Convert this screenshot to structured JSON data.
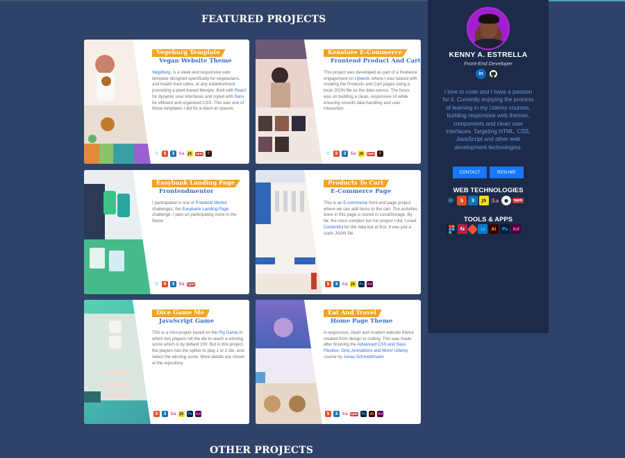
{
  "sections": {
    "featured": "FEATURED PROJECTS",
    "other": "OTHER PROJECTS"
  },
  "projects": [
    {
      "title": "Vegeburg Template",
      "subtitle": "Vegan Website Theme",
      "desc": [
        {
          "t": "Vegeburg",
          "link": true
        },
        {
          "t": ", is a sleek and responsive web template designed specifically for vegetarians, and health food cafes, or any establishment promoting a plant-based lifestyle. Built with ",
          "link": false
        },
        {
          "t": "React",
          "link": true
        },
        {
          "t": " for dynamic user interfaces and styled with ",
          "link": false
        },
        {
          "t": "Sass",
          "link": true
        },
        {
          "t": " for efficient and organized CSS. This was one of those templates I did for a client at Upwork.",
          "link": false
        }
      ],
      "techs": [
        "react",
        "html5",
        "css3",
        "sass",
        "javascript",
        "npm",
        "figma"
      ]
    },
    {
      "title": "Kenstore E-Commerce",
      "subtitle": "Frontend Product And Cart",
      "desc": [
        {
          "t": "This project was developed as part of a freelance engagement on ",
          "link": false
        },
        {
          "t": "Upwork",
          "link": true
        },
        {
          "t": ", where I was tasked with creating the Products and Cart pages using a local JSON file as the data source. The focus was on building a clean, responsive UI while ensuring smooth data handling and user interaction.",
          "link": false
        }
      ],
      "techs": [
        "react",
        "html5",
        "css3",
        "sass",
        "javascript",
        "npm",
        "figma"
      ]
    },
    {
      "title": "Easybank Landing Page",
      "subtitle": "Frontendmentor",
      "desc": [
        {
          "t": "I participated in one of ",
          "link": false
        },
        {
          "t": "Frontend Mentor",
          "link": true
        },
        {
          "t": " challenges, the ",
          "link": false
        },
        {
          "t": "Easybank Landing Page",
          "link": true
        },
        {
          "t": " challenge. I plan on participating more in the future.",
          "link": false
        }
      ],
      "techs": [
        "react",
        "html5",
        "css3",
        "sass",
        "npm"
      ]
    },
    {
      "title": "Products To Cart",
      "subtitle": "E-Commerce Page",
      "desc": [
        {
          "t": "This is an ",
          "link": false
        },
        {
          "t": "E-commerce",
          "link": true
        },
        {
          "t": " front-end page project where we can add items to the cart. The activities done in this page is stored in LocalStorage. By far, the most complex but fun project I did. I used ",
          "link": false
        },
        {
          "t": "Contentful",
          "link": true
        },
        {
          "t": " for the data but at first, it was just a static JSON file.",
          "link": false
        }
      ],
      "techs": [
        "html5",
        "css3",
        "sass",
        "javascript",
        "photoshop",
        "xd"
      ]
    },
    {
      "title": "Dice Game Me",
      "subtitle": "JavaScript Game",
      "desc": [
        {
          "t": "This is a mini-project based on the ",
          "link": false
        },
        {
          "t": "Pig Game",
          "link": true
        },
        {
          "t": " in which two players roll the die to reach a winning score which is by default 100. But in this project, the players has the option to play 1 or 2 die, and; select the winning score. More details are shown at the repository.",
          "link": false
        }
      ],
      "techs": [
        "html5",
        "css3",
        "sass",
        "javascript",
        "photoshop",
        "xd"
      ]
    },
    {
      "title": "Eat And Travel",
      "subtitle": "Home Page Theme",
      "desc": [
        {
          "t": "A responsive, clean and modern website theme created from design to coding. This was made after finishing the ",
          "link": false
        },
        {
          "t": "Advanced CSS and Sass: Flexbox, Grid, Animations and More! Udemy",
          "link": true
        },
        {
          "t": " course by ",
          "link": false
        },
        {
          "t": "Jonas Schmedtmann",
          "link": true
        }
      ],
      "techs": [
        "html5",
        "css3",
        "sass",
        "npm",
        "photoshop",
        "illustrator",
        "xd"
      ]
    }
  ],
  "profile": {
    "name": "KENNY A. ESTRELLA",
    "role": "Front-End Developer",
    "bio": "I love to code and I have a passion for it. Currently enjoying the process of learning in my Udemy courses, building responsive web themes, components and clean user interfaces. Targeting HTML, CSS, JavaScript and other web development technologies.",
    "contact_label": "CONTACT",
    "resume_label": "RESUME",
    "web_tech_title": "WEB TECHNOLOGIES",
    "tools_title": "TOOLS & APPS",
    "web_tech_icons": [
      "react-icon",
      "html5-icon",
      "css3-icon",
      "javascript-icon",
      "sass-icon",
      "github-icon",
      "npm-icon"
    ],
    "tools_icons": [
      "figma-icon",
      "freecodecamp-icon",
      "git-icon",
      "vscode-icon",
      "illustrator-icon",
      "photoshop-icon",
      "xd-icon"
    ]
  },
  "colors": {
    "background": "#2f4368",
    "panel": "#1c2b4a",
    "banner": "#f5a21d",
    "subtitle": "#3d6ec2",
    "link": "#2e6bd6",
    "button": "#1677ff",
    "bio": "#6e9ae0"
  }
}
